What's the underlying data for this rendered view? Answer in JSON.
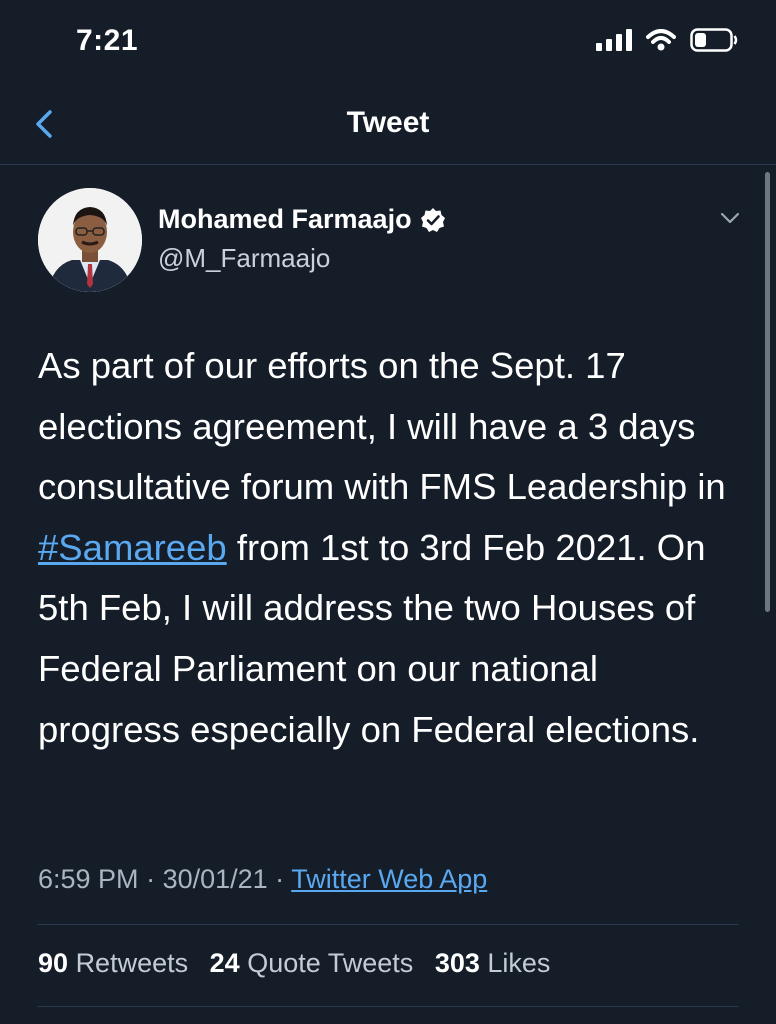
{
  "status_bar": {
    "time": "7:21"
  },
  "header": {
    "title": "Tweet"
  },
  "author": {
    "name": "Mohamed Farmaajo",
    "handle": "@M_Farmaajo"
  },
  "tweet": {
    "text_before": "As part of our efforts on the Sept. 17 elections agreement, I will have a 3 days consultative forum with FMS Leadership in ",
    "hashtag": "#Samareeb",
    "text_after": " from 1st to 3rd Feb 2021. On 5th Feb, I will address the two Houses of Federal Parliament on our national progress especially on Federal elections."
  },
  "meta": {
    "time": "6:59 PM",
    "date": "30/01/21",
    "separator": " · ",
    "source": "Twitter Web App"
  },
  "stats": {
    "retweets_count": "90",
    "retweets_label": "Retweets",
    "quotes_count": "24",
    "quotes_label": "Quote Tweets",
    "likes_count": "303",
    "likes_label": "Likes"
  },
  "colors": {
    "background": "#151d29",
    "accent": "#5aa9f0",
    "divider": "#2b3a4c"
  }
}
